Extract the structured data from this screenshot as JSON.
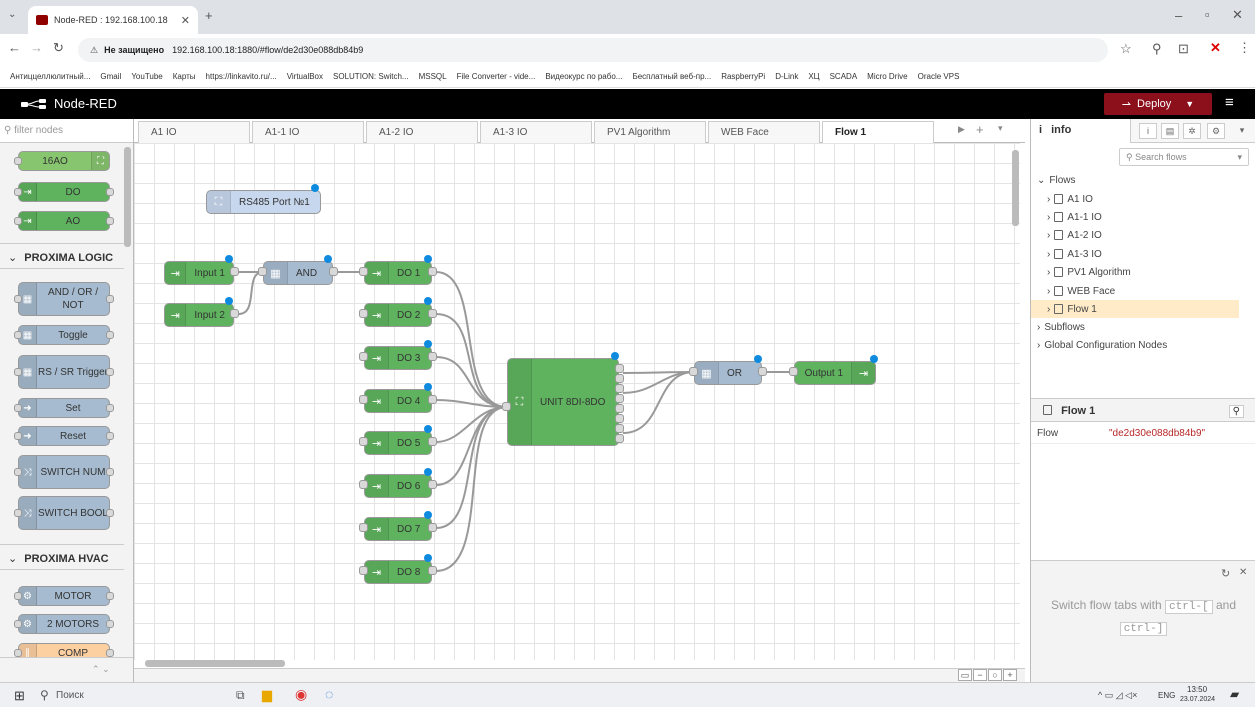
{
  "browser": {
    "tab_title": "Node-RED : 192.168.100.18",
    "url_warning": "Не защищено",
    "url": "192.168.100.18:1880/#flow/de2d30e088db84b9",
    "bookmarks": [
      "Антиццеллюлитный...",
      "Gmail",
      "YouTube",
      "Карты",
      "https://linkavito.ru/...",
      "VirtualBox",
      "SOLUTION: Switch...",
      "MSSQL",
      "File Converter - vide...",
      "Видеокурс по рабо...",
      "Бесплатный веб-пр...",
      "RaspberryPi",
      "D-Link",
      "ХЦ",
      "SCADA",
      "Micro Drive",
      "Oracle VPS"
    ]
  },
  "header": {
    "app_name": "Node-RED",
    "deploy_label": "Deploy"
  },
  "palette": {
    "filter_placeholder": "filter nodes",
    "top_nodes": [
      "16AO",
      "DO",
      "AO"
    ],
    "categories": [
      {
        "name": "PROXIMA LOGIC",
        "nodes": [
          "AND / OR / NOT",
          "Toggle",
          "RS / SR Trigger",
          "Set",
          "Reset",
          "SWITCH NUM",
          "SWITCH BOOL"
        ]
      },
      {
        "name": "PROXIMA HVAC",
        "nodes": [
          "MOTOR",
          "2 MOTORS",
          "COMP"
        ]
      }
    ]
  },
  "workspace": {
    "tabs": [
      "A1 IO",
      "A1-1 IO",
      "A1-2 IO",
      "A1-3 IO",
      "PV1 Algorithm",
      "WEB Face",
      "Flow 1"
    ],
    "active_tab": "Flow 1",
    "nodes": {
      "rs485": "RS485 Port №1",
      "input1": "Input 1",
      "input2": "Input 2",
      "and": "AND",
      "do": [
        "DO 1",
        "DO 2",
        "DO 3",
        "DO 4",
        "DO 5",
        "DO 6",
        "DO 7",
        "DO 8"
      ],
      "unit": "UNIT 8DI-8DO",
      "or": "OR",
      "output1": "Output 1"
    }
  },
  "sidebar": {
    "tab_label": "info",
    "search_placeholder": "Search flows",
    "flows_label": "Flows",
    "flows": [
      "A1 IO",
      "A1-1 IO",
      "A1-2 IO",
      "A1-3 IO",
      "PV1 Algorithm",
      "WEB Face",
      "Flow 1"
    ],
    "subflows_label": "Subflows",
    "global_label": "Global Configuration Nodes",
    "selected_title": "Flow 1",
    "flow_key": "Flow",
    "flow_value": "\"de2d30e088db84b9\"",
    "tip_pre": "Switch flow tabs with",
    "tip_key1": "ctrl-[",
    "tip_mid": "and",
    "tip_key2": "ctrl-]"
  },
  "taskbar": {
    "search": "Поиск",
    "lang": "ENG",
    "time": "13:50",
    "date": "23.07.2024"
  },
  "colors": {
    "green_node": "#87c66f",
    "light_green": "#5fb35f",
    "blue_node": "#a6bbcf",
    "orange_node": "#fdd0a2",
    "deploy": "#8c101c"
  }
}
